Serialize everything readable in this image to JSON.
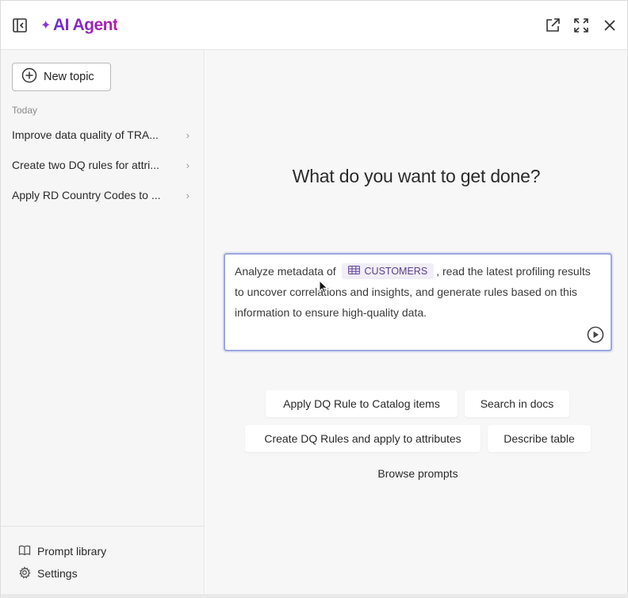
{
  "header": {
    "brand": "AI Agent",
    "brand_mark": "✦",
    "icons": [
      "sidebar-toggle-icon",
      "open-external-icon",
      "expand-icon",
      "close-icon"
    ],
    "accent": "#7a2ec7"
  },
  "sidebar": {
    "new_topic_label": "New topic",
    "section_label": "Today",
    "topics": [
      {
        "label": "Improve data quality of TRA..."
      },
      {
        "label": "Create two DQ rules for attri..."
      },
      {
        "label": "Apply RD Country Codes to ..."
      }
    ],
    "footer": {
      "prompt_library": "Prompt library",
      "settings": "Settings"
    }
  },
  "main": {
    "headline": "What do you want to get done?",
    "prompt": {
      "text_before": "Analyze metadata of",
      "chip_label": "CUSTOMERS",
      "text_after": ", read the latest profiling results to uncover correlations and insights, and generate rules based on this information to ensure high-quality data."
    },
    "suggestions": [
      "Apply DQ Rule to Catalog items",
      "Search in docs",
      "Create DQ Rules and apply to attributes",
      "Describe table"
    ],
    "browse_prompts": "Browse prompts"
  }
}
